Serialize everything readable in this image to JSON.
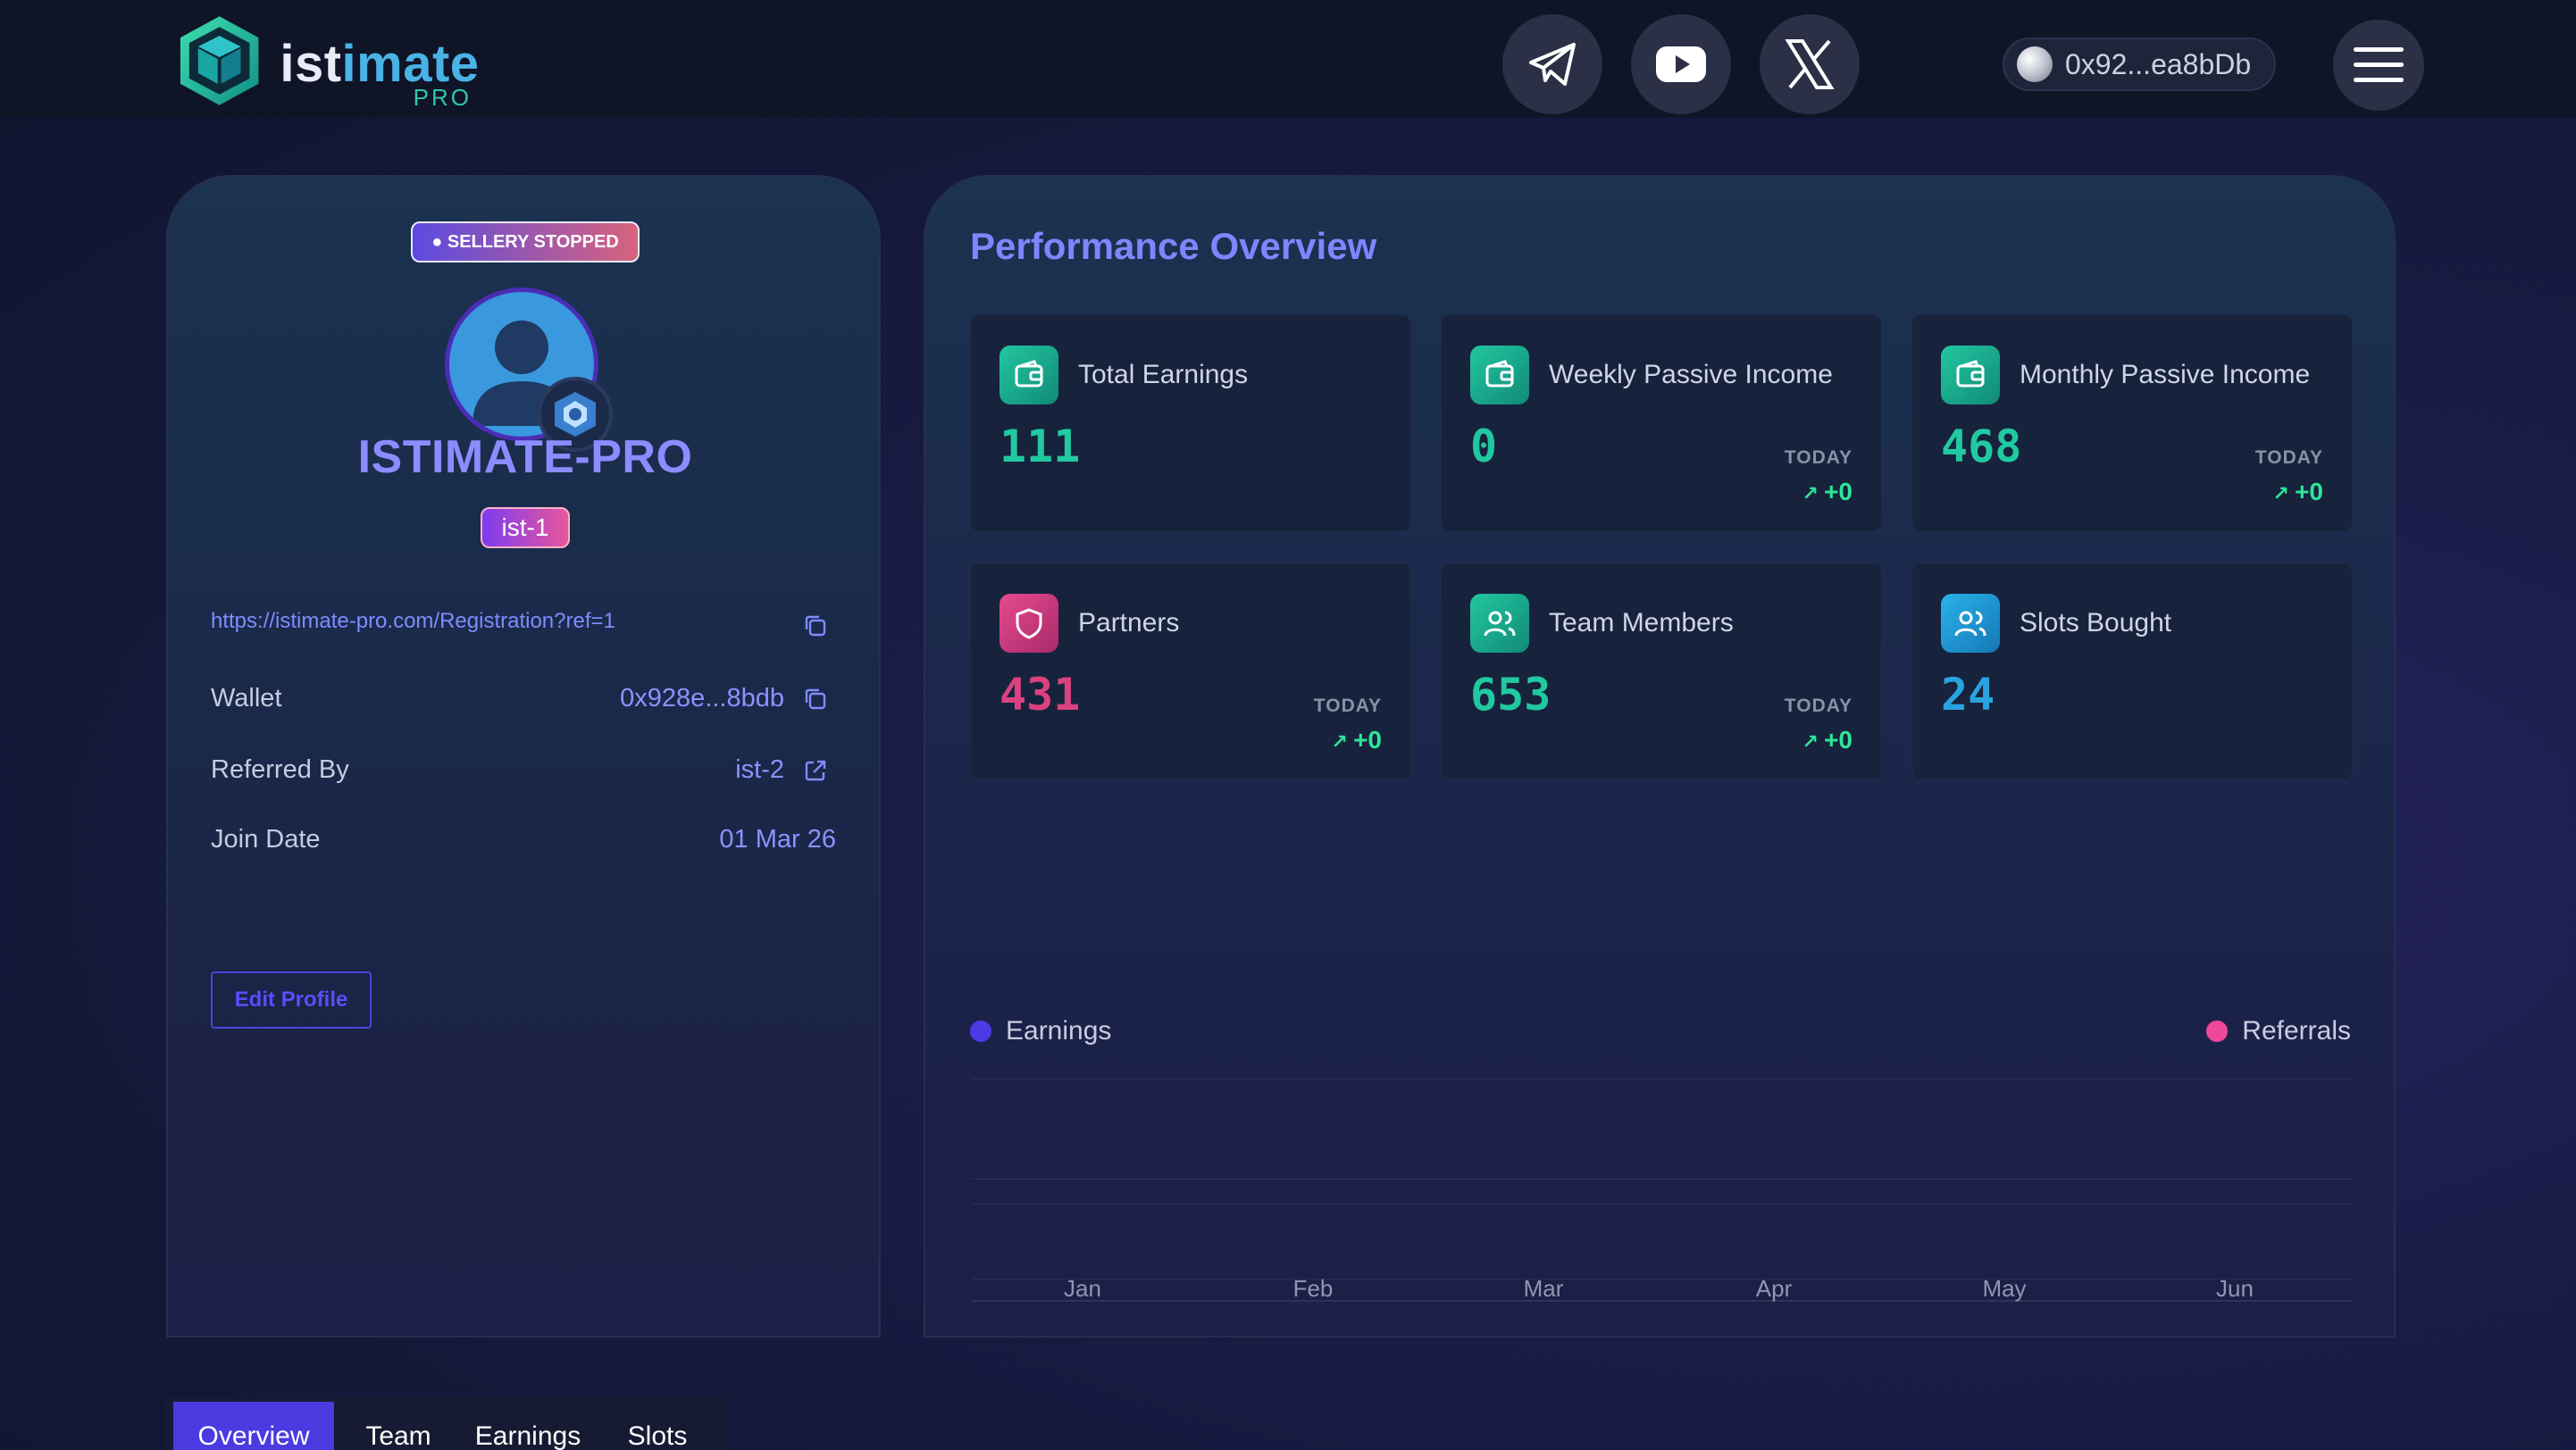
{
  "header": {
    "brand_name_a": "ist",
    "brand_name_b": "imate",
    "brand_sub": "PRO",
    "social": [
      {
        "name": "telegram-icon"
      },
      {
        "name": "youtube-icon"
      },
      {
        "name": "x-icon"
      }
    ],
    "wallet_address": "0x92...ea8bDb",
    "menu_icon": "hamburger-icon"
  },
  "profile": {
    "status_badge": "● SELLERY STOPPED",
    "name": "ISTIMATE-PRO",
    "id_badge": "ist-1",
    "referral_link": "https://istimate-pro.com/Registration?ref=1",
    "wallet_label": "Wallet",
    "wallet_value": "0x928e...8bdb",
    "referred_label": "Referred By",
    "referred_value": "ist-2",
    "join_label": "Join Date",
    "join_value": "01 Mar 26",
    "edit_button": "Edit Profile"
  },
  "performance": {
    "title": "Performance Overview",
    "cards": [
      {
        "label": "Total Earnings",
        "value": "111",
        "color": "#20c9a0"
      },
      {
        "label": "Weekly Passive Income",
        "value": "0",
        "today_label": "TODAY",
        "today_delta": "+0",
        "color": "#20c9a0"
      },
      {
        "label": "Monthly Passive Income",
        "value": "468",
        "today_label": "TODAY",
        "today_delta": "+0",
        "color": "#20c9a0"
      },
      {
        "label": "Partners",
        "value": "431",
        "today_label": "TODAY",
        "today_delta": "+0",
        "color": "#d9417f"
      },
      {
        "label": "Team Members",
        "value": "653",
        "today_label": "TODAY",
        "today_delta": "+0",
        "color": "#20c9a0"
      },
      {
        "label": "Slots Bought",
        "value": "24",
        "color": "#2aa3e0"
      }
    ],
    "legend": {
      "earnings": "Earnings",
      "referrals": "Referrals",
      "earnings_color": "#4b3ae6",
      "referrals_color": "#f0479a"
    },
    "x_ticks": [
      "Jan",
      "Feb",
      "Mar",
      "Apr",
      "May",
      "Jun"
    ]
  },
  "tabs": [
    {
      "label": "Overview",
      "active": true
    },
    {
      "label": "Team",
      "active": false
    },
    {
      "label": "Earnings",
      "active": false
    },
    {
      "label": "Slots",
      "active": false
    }
  ]
}
